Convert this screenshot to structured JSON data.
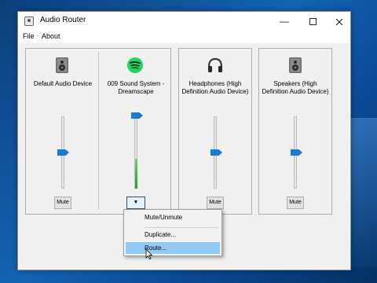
{
  "window": {
    "title": "Audio Router",
    "minimize_icon": "minimize-icon",
    "maximize_icon": "maximize-icon",
    "close_icon": "close-icon"
  },
  "menu": {
    "file": "File",
    "about": "About"
  },
  "panels": [
    {
      "devices": [
        {
          "label": "Default Audio Device",
          "icon": "speaker-icon",
          "volume_percent": 50,
          "control": "Mute"
        },
        {
          "label": "009 Sound System - Dreamscape",
          "icon": "spotify-icon",
          "volume_percent": 100,
          "level_percent": 40,
          "control": "▼"
        }
      ]
    },
    {
      "devices": [
        {
          "label": "Headphones (High Definition Audio Device)",
          "icon": "headphones-icon",
          "volume_percent": 50,
          "control": "Mute"
        }
      ]
    },
    {
      "devices": [
        {
          "label": "Speakers (High Definition Audio Device)",
          "icon": "speaker-icon",
          "volume_percent": 50,
          "control": "Mute"
        }
      ]
    }
  ],
  "context_menu": {
    "items": [
      "Mute/Unmute",
      "Duplicate...",
      "Route..."
    ],
    "hovered": "Route..."
  },
  "colors": {
    "accent": "#1e78d6",
    "menu_hover": "#91c9f7",
    "meter": "#3cb043",
    "spotify": "#1ed760"
  }
}
